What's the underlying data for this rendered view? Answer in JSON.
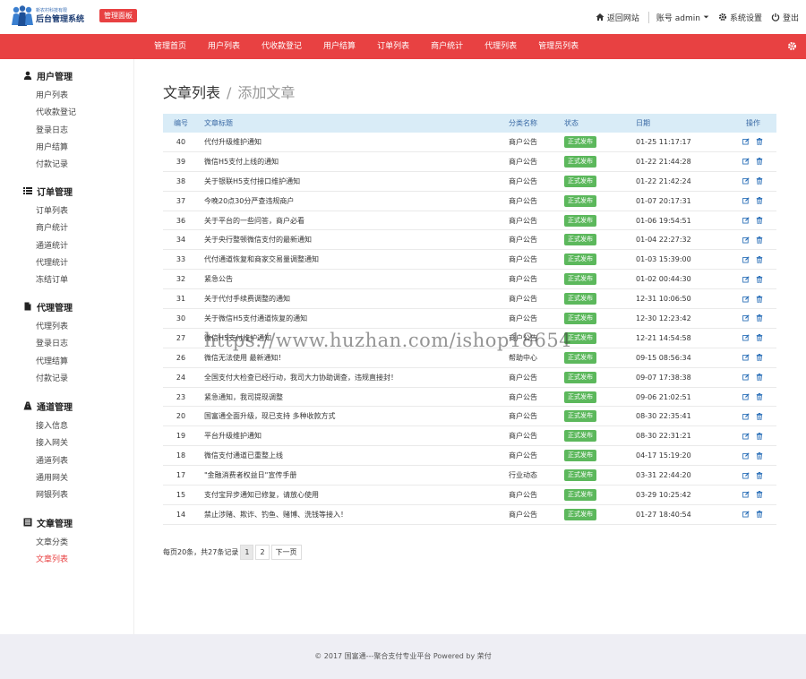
{
  "header": {
    "logo_small": "新农村科技有限",
    "logo_main": "后台管理系统",
    "admin_badge": "管理面板",
    "back_site": "返回网站",
    "account": "账号 admin",
    "settings": "系统设置",
    "logout": "登出"
  },
  "nav": {
    "items": [
      "管理首页",
      "用户列表",
      "代收款登记",
      "用户结算",
      "订单列表",
      "商户统计",
      "代理列表",
      "管理员列表"
    ]
  },
  "sidebar": {
    "groups": [
      {
        "title": "用户管理",
        "icon": "user-icon",
        "items": [
          "用户列表",
          "代收款登记",
          "登录日志",
          "用户结算",
          "付款记录"
        ]
      },
      {
        "title": "订单管理",
        "icon": "list-icon",
        "items": [
          "订单列表",
          "商户统计",
          "通道统计",
          "代理统计",
          "冻结订单"
        ]
      },
      {
        "title": "代理管理",
        "icon": "document-icon",
        "items": [
          "代理列表",
          "登录日志",
          "代理结算",
          "付款记录"
        ]
      },
      {
        "title": "通道管理",
        "icon": "road-icon",
        "items": [
          "接入信息",
          "接入网关",
          "通道列表",
          "通用网关",
          "网银列表"
        ]
      },
      {
        "title": "文章管理",
        "icon": "article-icon",
        "items": [
          "文章分类",
          "文章列表"
        ]
      }
    ],
    "active": "文章列表"
  },
  "main": {
    "title": "文章列表",
    "separator": "/",
    "add_link": "添加文章",
    "columns": [
      "编号",
      "文章标题",
      "分类名称",
      "状态",
      "日期",
      "操作"
    ],
    "rows": [
      {
        "id": "40",
        "title": "代付升级维护通知",
        "cat": "商户公告",
        "status": "正式发布",
        "date": "01-25 11:17:17"
      },
      {
        "id": "39",
        "title": "微信H5支付上线的通知",
        "cat": "商户公告",
        "status": "正式发布",
        "date": "01-22 21:44:28"
      },
      {
        "id": "38",
        "title": "关于银联H5支付接口维护通知",
        "cat": "商户公告",
        "status": "正式发布",
        "date": "01-22 21:42:24"
      },
      {
        "id": "37",
        "title": "今晚20点30分严查违规商户",
        "cat": "商户公告",
        "status": "正式发布",
        "date": "01-07 20:17:31"
      },
      {
        "id": "36",
        "title": "关于平台的一些问答，商户必看",
        "cat": "商户公告",
        "status": "正式发布",
        "date": "01-06 19:54:51"
      },
      {
        "id": "34",
        "title": "关于央行整顿微信支付的最新通知",
        "cat": "商户公告",
        "status": "正式发布",
        "date": "01-04 22:27:32"
      },
      {
        "id": "33",
        "title": "代付通道恢复和商家交易量调整通知",
        "cat": "商户公告",
        "status": "正式发布",
        "date": "01-03 15:39:00"
      },
      {
        "id": "32",
        "title": "紧急公告",
        "cat": "商户公告",
        "status": "正式发布",
        "date": "01-02 00:44:30"
      },
      {
        "id": "31",
        "title": "关于代付手续费调整的通知",
        "cat": "商户公告",
        "status": "正式发布",
        "date": "12-31 10:06:50"
      },
      {
        "id": "30",
        "title": "关于微信H5支付通道恢复的通知",
        "cat": "商户公告",
        "status": "正式发布",
        "date": "12-30 12:23:42"
      },
      {
        "id": "27",
        "title": "微信H5支付维护通知",
        "cat": "商户公告",
        "status": "正式发布",
        "date": "12-21 14:54:58"
      },
      {
        "id": "26",
        "title": "微信无法使用 最新通知！",
        "cat": "帮助中心",
        "status": "正式发布",
        "date": "09-15 08:56:34"
      },
      {
        "id": "24",
        "title": "全国支付大检查已经行动，我司大力协助调查，违规直接封！",
        "cat": "商户公告",
        "status": "正式发布",
        "date": "09-07 17:38:38"
      },
      {
        "id": "23",
        "title": "紧急通知，我司提现调整",
        "cat": "商户公告",
        "status": "正式发布",
        "date": "09-06 21:02:51"
      },
      {
        "id": "20",
        "title": "国富通全面升级，现已支持 多种收款方式",
        "cat": "商户公告",
        "status": "正式发布",
        "date": "08-30 22:35:41"
      },
      {
        "id": "19",
        "title": "平台升级维护通知",
        "cat": "商户公告",
        "status": "正式发布",
        "date": "08-30 22:31:21"
      },
      {
        "id": "18",
        "title": "微信支付通道已重整上线",
        "cat": "商户公告",
        "status": "正式发布",
        "date": "04-17 15:19:20"
      },
      {
        "id": "17",
        "title": "\"金融消费者权益日\"宣传手册",
        "cat": "行业动态",
        "status": "正式发布",
        "date": "03-31 22:44:20"
      },
      {
        "id": "15",
        "title": "支付宝异步通知已修复，请放心使用",
        "cat": "商户公告",
        "status": "正式发布",
        "date": "03-29 10:25:42"
      },
      {
        "id": "14",
        "title": "禁止涉赌、欺诈、钓鱼、赌博、洗钱等接入！",
        "cat": "商户公告",
        "status": "正式发布",
        "date": "01-27 18:40:54"
      }
    ],
    "pager": {
      "summary": "每页20条，共27条记录",
      "pages": [
        "1",
        "2"
      ],
      "next": "下一页"
    }
  },
  "footer": {
    "text": "© 2017  国富通---聚合支付专业平台 Powered by 荣付"
  },
  "watermark": "https://www.huzhan.com/ishop18654",
  "colors": {
    "brand_red": "#e84142",
    "badge_green": "#5cb85c",
    "thead_bg": "#d9ecf7",
    "footer_bg": "#eeeef4"
  }
}
